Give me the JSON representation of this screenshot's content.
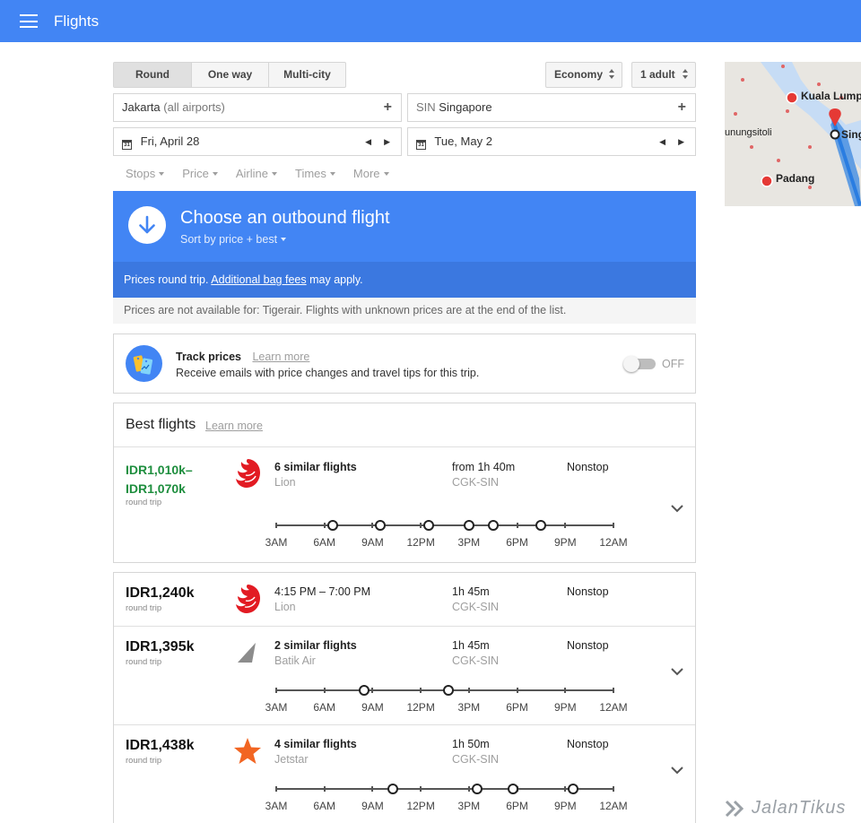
{
  "app": {
    "title": "Flights"
  },
  "search": {
    "trip_types": [
      "Round trip",
      "One way",
      "Multi-city"
    ],
    "cabin": "Economy",
    "passengers": "1 adult",
    "origin": {
      "name": "Jakarta",
      "detail": "(all airports)"
    },
    "destination": {
      "code": "SIN",
      "name": "Singapore"
    },
    "depart_date": "Fri, April 28",
    "return_date": "Tue, May 2",
    "calendar_icon_text": "31"
  },
  "filters": [
    "Stops",
    "Price",
    "Airline",
    "Times",
    "More"
  ],
  "outbound": {
    "title": "Choose an outbound flight",
    "sort": "Sort by price + best",
    "prices_note_pre": "Prices round trip.",
    "prices_note_link": "Additional bag fees",
    "prices_note_post": "may apply."
  },
  "notice": "Prices are not available for: Tigerair. Flights with unknown prices are at the end of the list.",
  "track_prices": {
    "title": "Track prices",
    "learn_more": "Learn more",
    "description": "Receive emails with price changes and travel tips for this trip.",
    "toggle_state": "OFF"
  },
  "best_flights": {
    "title": "Best flights",
    "learn_more": "Learn more"
  },
  "timeline_labels": [
    "3AM",
    "6AM",
    "9AM",
    "12PM",
    "3PM",
    "6PM",
    "9PM",
    "12AM"
  ],
  "flights": [
    {
      "price_line1": "IDR1,010k–",
      "price_line2": "IDR1,070k",
      "price_note": "round trip",
      "title": "6 similar flights",
      "airline": "Lion",
      "duration": "from 1h 40m",
      "route": "CGK-SIN",
      "stops": "Nonstop",
      "logo": "lion-air-logo",
      "departure_hours": [
        6.5,
        9.5,
        12.5,
        15,
        16.5,
        19.5
      ]
    },
    {
      "price_line1": "IDR1,240k",
      "price_note": "round trip",
      "title": "4:15 PM – 7:00 PM",
      "airline": "Lion",
      "duration": "1h 45m",
      "route": "CGK-SIN",
      "stops": "Nonstop",
      "logo": "lion-air-logo"
    },
    {
      "price_line1": "IDR1,395k",
      "price_note": "round trip",
      "title": "2 similar flights",
      "airline": "Batik Air",
      "duration": "1h 45m",
      "route": "CGK-SIN",
      "stops": "Nonstop",
      "logo": "batik-air-logo",
      "departure_hours": [
        8.5,
        13.75
      ]
    },
    {
      "price_line1": "IDR1,438k",
      "price_note": "round trip",
      "title": "4 similar flights",
      "airline": "Jetstar",
      "duration": "1h 50m",
      "route": "CGK-SIN",
      "stops": "Nonstop",
      "logo": "jetstar-logo",
      "departure_hours": [
        10.25,
        15.5,
        17.75,
        21.5
      ]
    }
  ],
  "map": {
    "labels": [
      "Kuala Lump",
      "Sing",
      "unungsitoli",
      "Padang"
    ]
  },
  "watermark": "JalanTikus",
  "colors": {
    "primary": "#4285f4",
    "price_green": "#1e8e3e",
    "lion_red": "#e21b23",
    "jetstar_orange": "#f26522"
  }
}
